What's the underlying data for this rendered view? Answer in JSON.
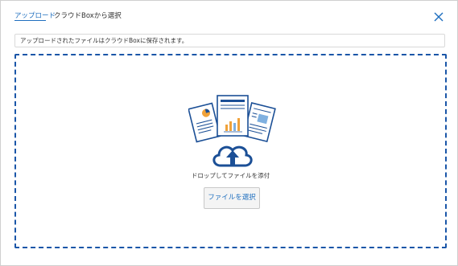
{
  "tabs": {
    "upload": "アップロード",
    "box": "クラウドBoxから選択"
  },
  "info": {
    "message": "アップロードされたファイルはクラウドBoxに保存されます。"
  },
  "dropzone": {
    "prompt": "ドロップしてファイルを添付",
    "select_button": "ファイルを選択"
  },
  "icons": {
    "close": "close-icon",
    "upload": "cloud-upload-icon",
    "documents": "documents-illustration"
  },
  "colors": {
    "accent": "#1f6fbf",
    "border_dashed": "#1a56a8",
    "illustration": "#1b4f96"
  }
}
